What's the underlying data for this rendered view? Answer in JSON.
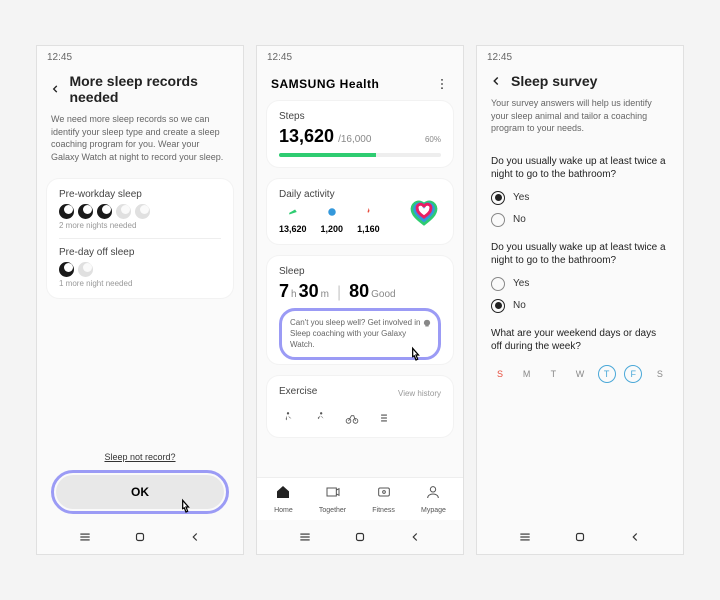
{
  "time": "12:45",
  "screen1": {
    "title": "More sleep records needed",
    "desc": "We need more sleep records so we can identify your sleep type and create a sleep coaching program for you. Wear your Galaxy Watch at night to record your sleep.",
    "pre_workday": "Pre-workday sleep",
    "pre_workday_sub": "2 more nights needed",
    "pre_dayoff": "Pre-day off sleep",
    "pre_dayoff_sub": "1 more night needed",
    "link": "Sleep not record?",
    "ok": "OK"
  },
  "screen2": {
    "brand": "SAMSUNG Health",
    "steps_lbl": "Steps",
    "steps_val": "13,620",
    "steps_goal": "/16,000",
    "steps_pct": "60%",
    "daily_lbl": "Daily activity",
    "act1": "13,620",
    "act2": "1,200",
    "act3": "1,160",
    "sleep_lbl": "Sleep",
    "sleep_h": "7",
    "sleep_h_u": "h",
    "sleep_m": "30",
    "sleep_m_u": "m",
    "sleep_score": "80",
    "sleep_q": "Good",
    "coach": "Can't you sleep well? Get involved in Sleep coaching with your Galaxy Watch.",
    "exercise_lbl": "Exercise",
    "view_history": "View history",
    "tabs": {
      "home": "Home",
      "together": "Together",
      "fitness": "Fitness",
      "mypage": "Mypage"
    }
  },
  "screen3": {
    "title": "Sleep survey",
    "desc": "Your survey answers will help us identify your sleep animal and tailor a coaching program to your needs.",
    "q1": "Do you usually wake up at least twice a night to go to the bathroom?",
    "yes": "Yes",
    "no": "No",
    "q2": "Do you usually wake up at least twice a night to go to the bathroom?",
    "q3": "What are your weekend days or days off during the week?",
    "days": [
      "S",
      "M",
      "T",
      "W",
      "T",
      "F",
      "S"
    ]
  }
}
